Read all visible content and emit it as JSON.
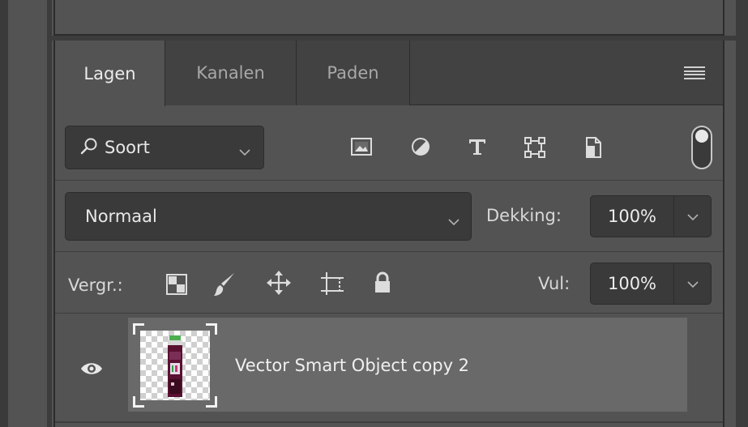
{
  "tabs": [
    {
      "label": "Lagen",
      "active": true
    },
    {
      "label": "Kanalen",
      "active": false
    },
    {
      "label": "Paden",
      "active": false
    }
  ],
  "panel_menu_icon": "hamburger-icon",
  "filter": {
    "kind_label": "Soort",
    "search_icon": "search-icon",
    "icons": [
      "image-layer-filter-icon",
      "adjustment-layer-filter-icon",
      "text-layer-filter-icon",
      "shape-layer-filter-icon",
      "smart-object-filter-icon"
    ],
    "toggle_on": true
  },
  "blend": {
    "mode": "Normaal",
    "opacity_label": "Dekking:",
    "opacity_value": "100%"
  },
  "lock": {
    "label": "Vergr.:",
    "icons": [
      "lock-transparent-pixels-icon",
      "lock-image-pixels-icon",
      "lock-position-icon",
      "lock-artboard-icon",
      "lock-all-icon"
    ],
    "fill_label": "Vul:",
    "fill_value": "100%"
  },
  "layers": [
    {
      "name": "Vector Smart Object copy 2",
      "visible": true,
      "selected": true
    }
  ],
  "colors": {
    "panel_bg": "#535353",
    "tab_bg": "#424242",
    "field_bg": "#3a3a3a",
    "selected_row": "#696969"
  }
}
